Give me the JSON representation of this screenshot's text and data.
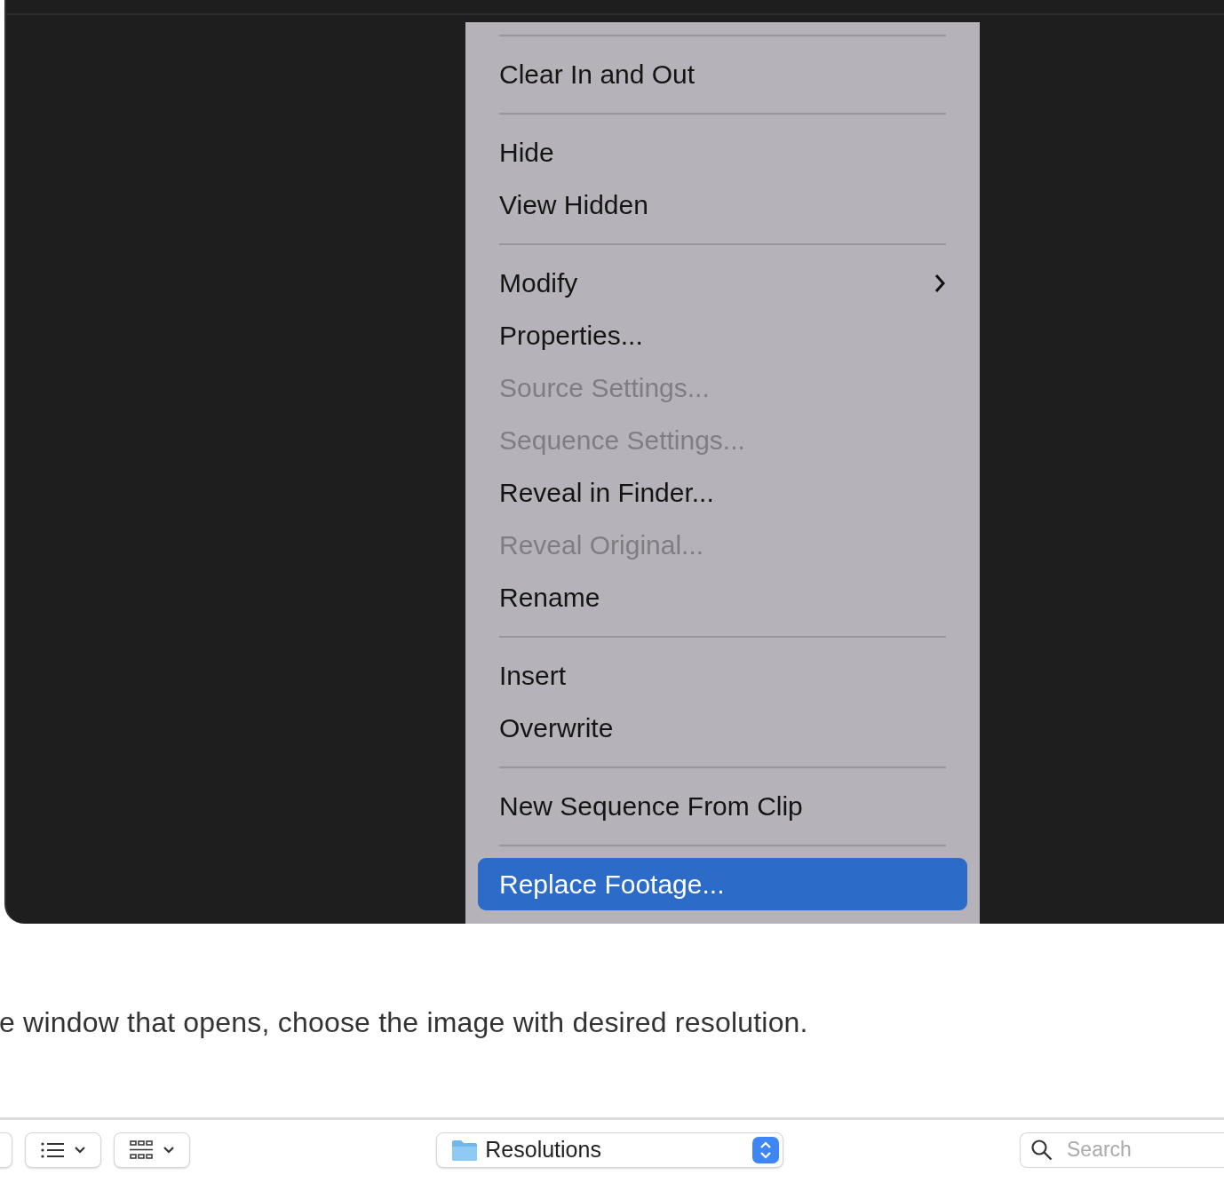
{
  "context_menu": {
    "items": [
      {
        "kind": "separator"
      },
      {
        "kind": "item",
        "label": "Clear In and Out",
        "disabled": false,
        "selected": false,
        "submenu": false
      },
      {
        "kind": "separator"
      },
      {
        "kind": "item",
        "label": "Hide",
        "disabled": false,
        "selected": false,
        "submenu": false
      },
      {
        "kind": "item",
        "label": "View Hidden",
        "disabled": false,
        "selected": false,
        "submenu": false
      },
      {
        "kind": "separator"
      },
      {
        "kind": "item",
        "label": "Modify",
        "disabled": false,
        "selected": false,
        "submenu": true
      },
      {
        "kind": "item",
        "label": "Properties...",
        "disabled": false,
        "selected": false,
        "submenu": false
      },
      {
        "kind": "item",
        "label": "Source Settings...",
        "disabled": true,
        "selected": false,
        "submenu": false
      },
      {
        "kind": "item",
        "label": "Sequence Settings...",
        "disabled": true,
        "selected": false,
        "submenu": false
      },
      {
        "kind": "item",
        "label": "Reveal in Finder...",
        "disabled": false,
        "selected": false,
        "submenu": false
      },
      {
        "kind": "item",
        "label": "Reveal Original...",
        "disabled": true,
        "selected": false,
        "submenu": false
      },
      {
        "kind": "item",
        "label": "Rename",
        "disabled": false,
        "selected": false,
        "submenu": false
      },
      {
        "kind": "separator"
      },
      {
        "kind": "item",
        "label": "Insert",
        "disabled": false,
        "selected": false,
        "submenu": false
      },
      {
        "kind": "item",
        "label": "Overwrite",
        "disabled": false,
        "selected": false,
        "submenu": false
      },
      {
        "kind": "separator"
      },
      {
        "kind": "item",
        "label": "New Sequence From Clip",
        "disabled": false,
        "selected": false,
        "submenu": false
      },
      {
        "kind": "separator"
      },
      {
        "kind": "item",
        "label": "Replace Footage...",
        "disabled": false,
        "selected": true,
        "submenu": false
      }
    ]
  },
  "caption": "e window that opens, choose the image with desired resolution.",
  "file_dialog": {
    "location": "Resolutions",
    "search": {
      "placeholder": "Search"
    }
  }
}
